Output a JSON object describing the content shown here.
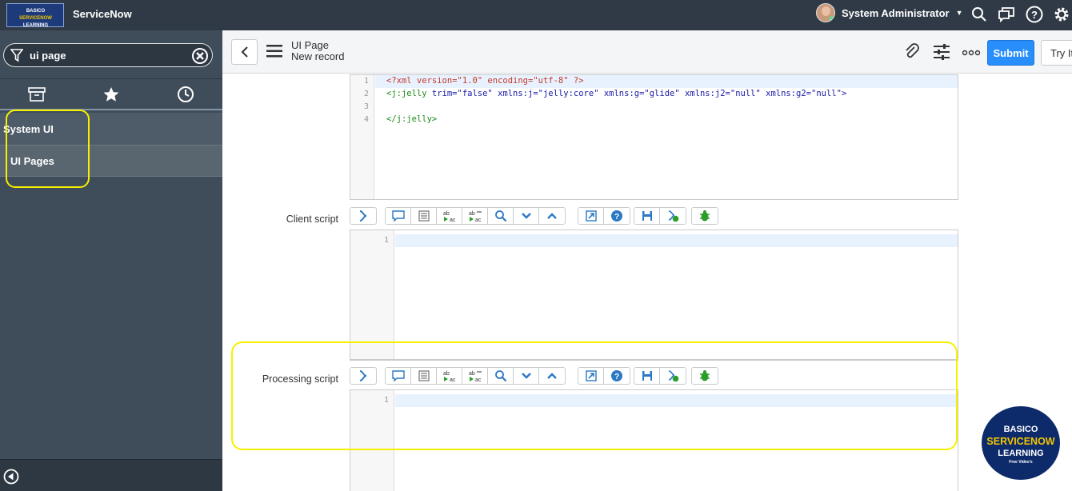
{
  "topbar": {
    "logo_line1_a": "BASICO",
    "logo_line1_b": "SERVICENOW",
    "logo_line2": "LEARNING",
    "brand": "ServiceNow",
    "user_name": "System Administrator"
  },
  "sidebar": {
    "filter_value": "ui page",
    "app_label": "System UI",
    "module_label": "UI Pages"
  },
  "header": {
    "title": "UI Page",
    "subtitle": "New record",
    "submit_label": "Submit",
    "tryit_label": "Try It"
  },
  "html_editor": {
    "line_numbers": [
      "1",
      "2",
      "3",
      "4"
    ],
    "line1": "<?xml version=\"1.0\" encoding=\"utf-8\" ?>",
    "line2_tag": "<j:jelly",
    "line2_attrs": " trim=\"false\" xmlns:j=\"jelly:core\" xmlns:g=\"glide\" xmlns:j2=\"null\" xmlns:g2=\"null\">",
    "line4": "</j:jelly>"
  },
  "client_script": {
    "label": "Client script",
    "line_number": "1"
  },
  "processing_script": {
    "label": "Processing script",
    "line_number": "1"
  },
  "watermark": {
    "line1": "BASICO",
    "line2": "SERVICENOW",
    "line3": "LEARNING",
    "line4": "Free Video's"
  },
  "colors": {
    "topbar": "#303a46",
    "sidebar": "#3f4c59",
    "submit": "#278efc",
    "highlight": "#f6f000"
  }
}
